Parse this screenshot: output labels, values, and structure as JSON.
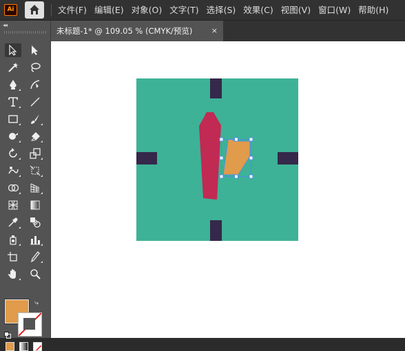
{
  "app": {
    "logo_text": "Ai"
  },
  "menus": [
    "文件(F)",
    "编辑(E)",
    "对象(O)",
    "文字(T)",
    "选择(S)",
    "效果(C)",
    "视图(V)",
    "窗口(W)",
    "帮助(H)"
  ],
  "document": {
    "tab_title": "未标题-1* @ 109.05 % (CMYK/预览)",
    "close_glyph": "×"
  },
  "toolbar": {
    "collapse_glyph": "◂◂",
    "swap_glyph": "⤷"
  },
  "colors": {
    "fill": "#e09b4b",
    "stroke": "none",
    "artboard_bg": "#3db296",
    "ticks": "#35284a",
    "hand": "#c02a53",
    "selected_shape": "#e09b4b",
    "selection": "#4a8fe7"
  },
  "tools": [
    "selection-tool",
    "direct-selection-tool",
    "magic-wand-tool",
    "lasso-tool",
    "pen-tool",
    "curvature-tool",
    "type-tool",
    "line-segment-tool",
    "rectangle-tool",
    "paintbrush-tool",
    "shaper-tool",
    "eraser-tool",
    "rotate-tool",
    "scale-tool",
    "puppet-warp-tool",
    "free-transform-tool",
    "shape-builder-tool",
    "perspective-grid-tool",
    "mesh-tool",
    "gradient-tool",
    "eyedropper-tool",
    "blend-tool",
    "symbol-sprayer-tool",
    "column-graph-tool",
    "artboard-tool",
    "slice-tool",
    "hand-tool",
    "zoom-tool"
  ]
}
